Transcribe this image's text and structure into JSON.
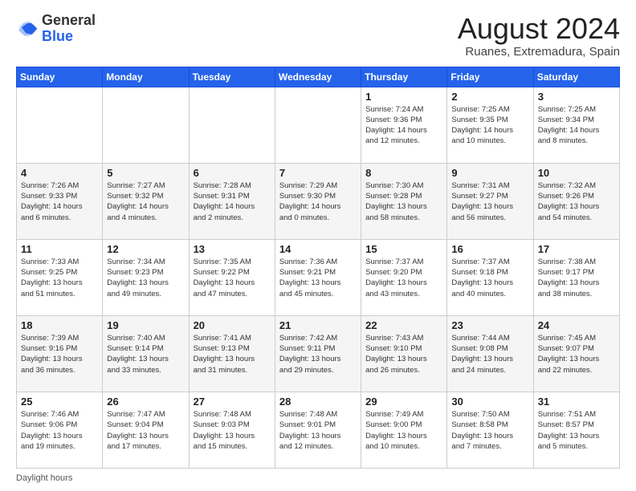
{
  "header": {
    "logo_general": "General",
    "logo_blue": "Blue",
    "month_year": "August 2024",
    "location": "Ruanes, Extremadura, Spain"
  },
  "footer": {
    "daylight_label": "Daylight hours"
  },
  "days_of_week": [
    "Sunday",
    "Monday",
    "Tuesday",
    "Wednesday",
    "Thursday",
    "Friday",
    "Saturday"
  ],
  "weeks": [
    [
      {
        "day": "",
        "info": ""
      },
      {
        "day": "",
        "info": ""
      },
      {
        "day": "",
        "info": ""
      },
      {
        "day": "",
        "info": ""
      },
      {
        "day": "1",
        "info": "Sunrise: 7:24 AM\nSunset: 9:36 PM\nDaylight: 14 hours\nand 12 minutes."
      },
      {
        "day": "2",
        "info": "Sunrise: 7:25 AM\nSunset: 9:35 PM\nDaylight: 14 hours\nand 10 minutes."
      },
      {
        "day": "3",
        "info": "Sunrise: 7:25 AM\nSunset: 9:34 PM\nDaylight: 14 hours\nand 8 minutes."
      }
    ],
    [
      {
        "day": "4",
        "info": "Sunrise: 7:26 AM\nSunset: 9:33 PM\nDaylight: 14 hours\nand 6 minutes."
      },
      {
        "day": "5",
        "info": "Sunrise: 7:27 AM\nSunset: 9:32 PM\nDaylight: 14 hours\nand 4 minutes."
      },
      {
        "day": "6",
        "info": "Sunrise: 7:28 AM\nSunset: 9:31 PM\nDaylight: 14 hours\nand 2 minutes."
      },
      {
        "day": "7",
        "info": "Sunrise: 7:29 AM\nSunset: 9:30 PM\nDaylight: 14 hours\nand 0 minutes."
      },
      {
        "day": "8",
        "info": "Sunrise: 7:30 AM\nSunset: 9:28 PM\nDaylight: 13 hours\nand 58 minutes."
      },
      {
        "day": "9",
        "info": "Sunrise: 7:31 AM\nSunset: 9:27 PM\nDaylight: 13 hours\nand 56 minutes."
      },
      {
        "day": "10",
        "info": "Sunrise: 7:32 AM\nSunset: 9:26 PM\nDaylight: 13 hours\nand 54 minutes."
      }
    ],
    [
      {
        "day": "11",
        "info": "Sunrise: 7:33 AM\nSunset: 9:25 PM\nDaylight: 13 hours\nand 51 minutes."
      },
      {
        "day": "12",
        "info": "Sunrise: 7:34 AM\nSunset: 9:23 PM\nDaylight: 13 hours\nand 49 minutes."
      },
      {
        "day": "13",
        "info": "Sunrise: 7:35 AM\nSunset: 9:22 PM\nDaylight: 13 hours\nand 47 minutes."
      },
      {
        "day": "14",
        "info": "Sunrise: 7:36 AM\nSunset: 9:21 PM\nDaylight: 13 hours\nand 45 minutes."
      },
      {
        "day": "15",
        "info": "Sunrise: 7:37 AM\nSunset: 9:20 PM\nDaylight: 13 hours\nand 43 minutes."
      },
      {
        "day": "16",
        "info": "Sunrise: 7:37 AM\nSunset: 9:18 PM\nDaylight: 13 hours\nand 40 minutes."
      },
      {
        "day": "17",
        "info": "Sunrise: 7:38 AM\nSunset: 9:17 PM\nDaylight: 13 hours\nand 38 minutes."
      }
    ],
    [
      {
        "day": "18",
        "info": "Sunrise: 7:39 AM\nSunset: 9:16 PM\nDaylight: 13 hours\nand 36 minutes."
      },
      {
        "day": "19",
        "info": "Sunrise: 7:40 AM\nSunset: 9:14 PM\nDaylight: 13 hours\nand 33 minutes."
      },
      {
        "day": "20",
        "info": "Sunrise: 7:41 AM\nSunset: 9:13 PM\nDaylight: 13 hours\nand 31 minutes."
      },
      {
        "day": "21",
        "info": "Sunrise: 7:42 AM\nSunset: 9:11 PM\nDaylight: 13 hours\nand 29 minutes."
      },
      {
        "day": "22",
        "info": "Sunrise: 7:43 AM\nSunset: 9:10 PM\nDaylight: 13 hours\nand 26 minutes."
      },
      {
        "day": "23",
        "info": "Sunrise: 7:44 AM\nSunset: 9:08 PM\nDaylight: 13 hours\nand 24 minutes."
      },
      {
        "day": "24",
        "info": "Sunrise: 7:45 AM\nSunset: 9:07 PM\nDaylight: 13 hours\nand 22 minutes."
      }
    ],
    [
      {
        "day": "25",
        "info": "Sunrise: 7:46 AM\nSunset: 9:06 PM\nDaylight: 13 hours\nand 19 minutes."
      },
      {
        "day": "26",
        "info": "Sunrise: 7:47 AM\nSunset: 9:04 PM\nDaylight: 13 hours\nand 17 minutes."
      },
      {
        "day": "27",
        "info": "Sunrise: 7:48 AM\nSunset: 9:03 PM\nDaylight: 13 hours\nand 15 minutes."
      },
      {
        "day": "28",
        "info": "Sunrise: 7:48 AM\nSunset: 9:01 PM\nDaylight: 13 hours\nand 12 minutes."
      },
      {
        "day": "29",
        "info": "Sunrise: 7:49 AM\nSunset: 9:00 PM\nDaylight: 13 hours\nand 10 minutes."
      },
      {
        "day": "30",
        "info": "Sunrise: 7:50 AM\nSunset: 8:58 PM\nDaylight: 13 hours\nand 7 minutes."
      },
      {
        "day": "31",
        "info": "Sunrise: 7:51 AM\nSunset: 8:57 PM\nDaylight: 13 hours\nand 5 minutes."
      }
    ]
  ]
}
